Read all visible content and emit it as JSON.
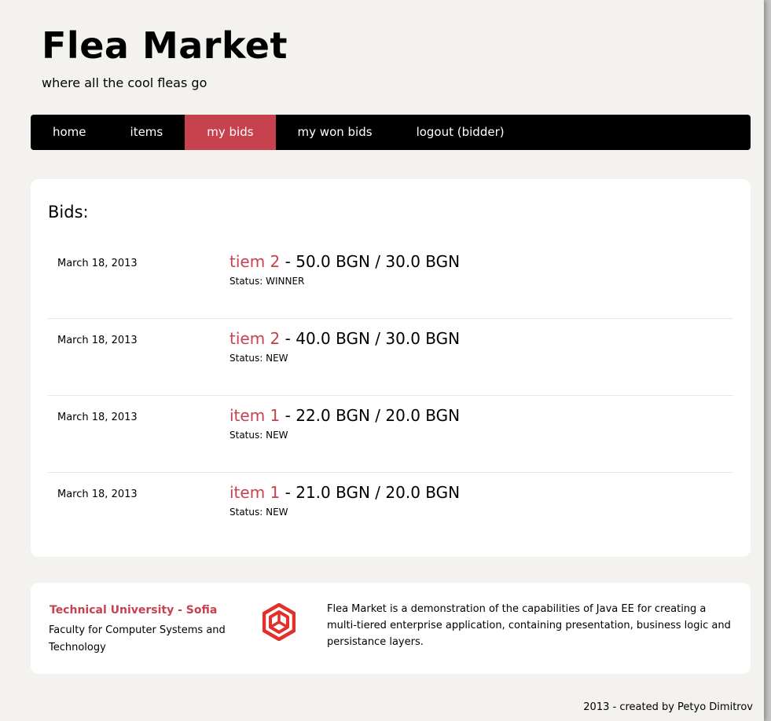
{
  "header": {
    "title": "Flea Market",
    "tagline": "where all the cool fleas go"
  },
  "nav": {
    "items": [
      {
        "label": "home"
      },
      {
        "label": "items"
      },
      {
        "label": "my bids",
        "active": true
      },
      {
        "label": "my won bids"
      },
      {
        "label": "logout (bidder)"
      }
    ]
  },
  "bids": {
    "heading": "Bids:",
    "rows": [
      {
        "date": "March 18, 2013",
        "item": "tiem 2",
        "amount": " - 50.0 BGN / 30.0 BGN",
        "status": "Status: WINNER"
      },
      {
        "date": "March 18, 2013",
        "item": "tiem 2",
        "amount": " - 40.0 BGN / 30.0 BGN",
        "status": "Status: NEW"
      },
      {
        "date": "March 18, 2013",
        "item": "item 1",
        "amount": " - 22.0 BGN / 20.0 BGN",
        "status": "Status: NEW"
      },
      {
        "date": "March 18, 2013",
        "item": "item 1",
        "amount": " - 21.0 BGN / 20.0 BGN",
        "status": "Status: NEW"
      }
    ]
  },
  "footer": {
    "university": "Technical University - Sofia",
    "faculty": "Faculty for Computer Systems and Technology",
    "logo_icon": "tu-sofia-logo-icon",
    "description": "Flea Market is a demonstration of the capabilities of Java EE for creating a multi-tiered enterprise application, containing presentation, business logic and persistance layers.",
    "copyright": "2013 - created by Petyo Dimitrov"
  },
  "colors": {
    "accent": "#c7424f",
    "nav_background": "#000000",
    "page_background": "#f4f2ee",
    "logo_red": "#e2302a"
  }
}
